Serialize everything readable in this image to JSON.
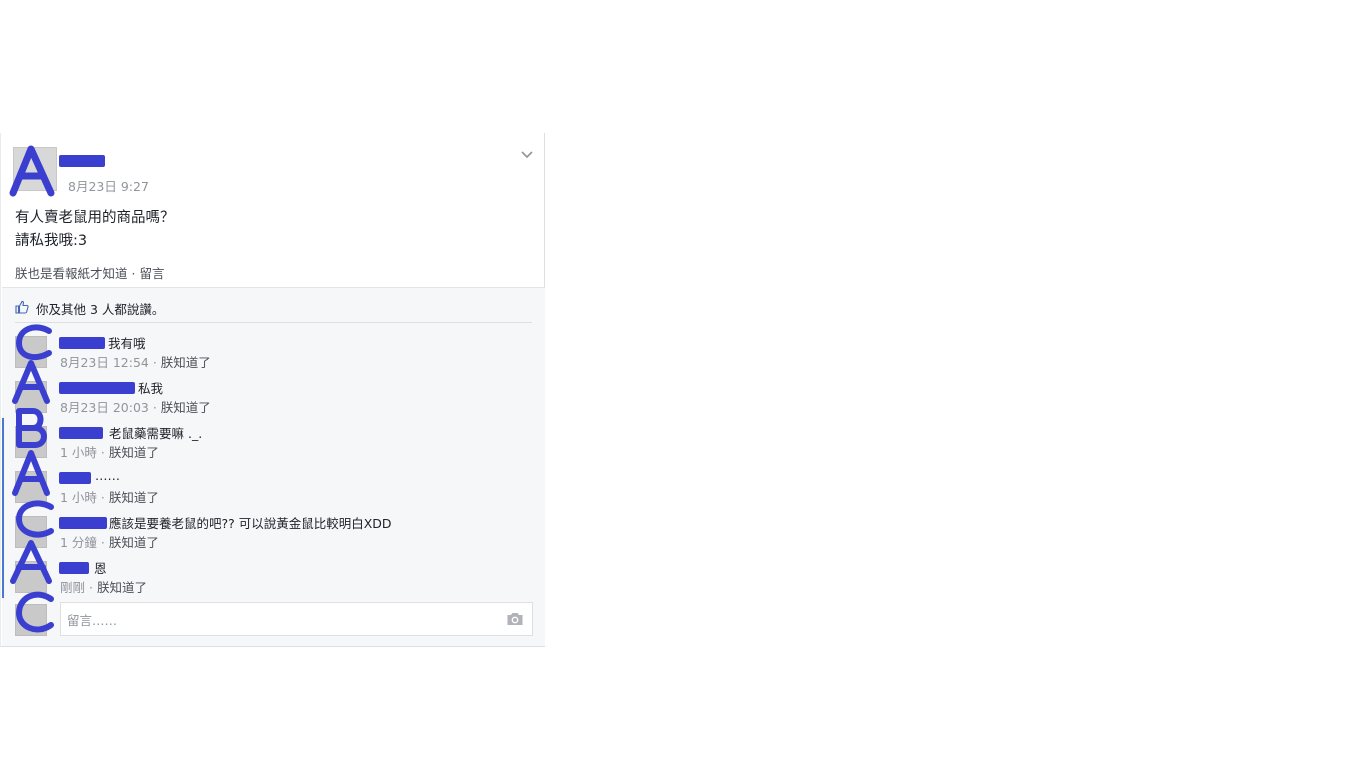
{
  "post": {
    "time": "8月23日 9:27",
    "text_line1": "有人賣老鼠用的商品嗎？",
    "text_line2": "請私我哦:3",
    "like_label": "朕也是看報紙才知道",
    "separator": " · ",
    "comment_label": "留言"
  },
  "likes": {
    "text": "你及其他 3 人都說讚。"
  },
  "comments": [
    {
      "text": "我有哦",
      "time": "8月23日 12:54",
      "like_label": "朕知道了"
    },
    {
      "text": "私我",
      "time": "8月23日 20:03",
      "like_label": "朕知道了"
    },
    {
      "text": "老鼠藥需要嘛 ._.",
      "time": "1 小時",
      "like_label": "朕知道了"
    },
    {
      "text": "……",
      "time": "1 小時",
      "like_label": "朕知道了"
    },
    {
      "text": "應該是要養老鼠的吧?? 可以說黃金鼠比較明白XDD",
      "time": "1 分鐘",
      "like_label": "朕知道了"
    },
    {
      "text": "恩",
      "time": "剛剛",
      "like_label": "朕知道了"
    }
  ],
  "reply": {
    "placeholder": "留言……"
  },
  "annotations": {
    "letters": [
      "A",
      "C",
      "B",
      "A",
      "B",
      "A",
      "C",
      "A",
      "C"
    ],
    "color": "#3a3fd0"
  },
  "icons": {
    "chevron": "chevron-down-icon",
    "like": "thumbs-up-icon",
    "camera": "camera-icon"
  }
}
